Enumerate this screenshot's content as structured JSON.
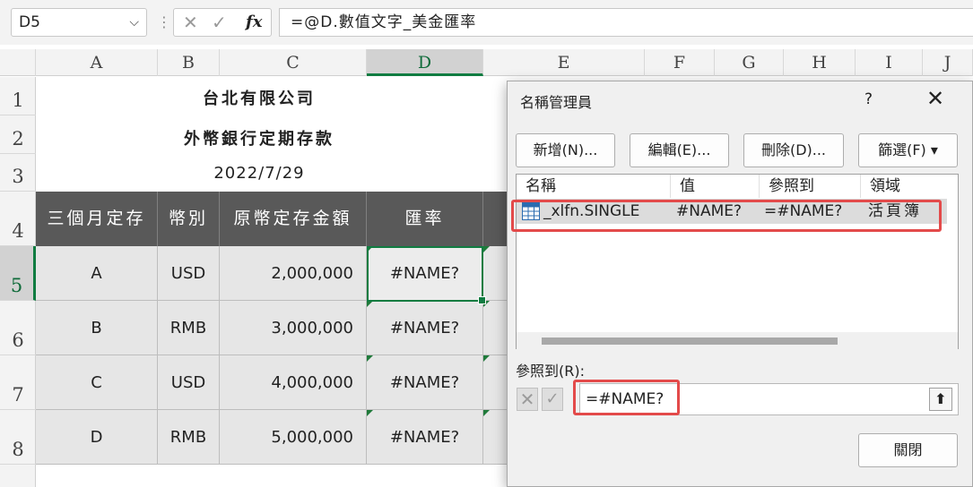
{
  "formula_bar": {
    "name_box": "D5",
    "cancel_icon": "✕",
    "enter_icon": "✓",
    "fx_label": "fx",
    "formula": "=@D.數值文字_美金匯率"
  },
  "columns": [
    "A",
    "B",
    "C",
    "D",
    "E",
    "F",
    "G",
    "H",
    "I",
    "J"
  ],
  "rows": [
    "1",
    "2",
    "3",
    "4",
    "5",
    "6",
    "7",
    "8"
  ],
  "sheet": {
    "title1": "台北有限公司",
    "title2": "外幣銀行定期存款",
    "date": "2022/7/29",
    "headers": [
      "三個月定存",
      "幣別",
      "原幣定存金額",
      "匯率"
    ],
    "data": [
      [
        "A",
        "USD",
        "2,000,000",
        "#NAME?"
      ],
      [
        "B",
        "RMB",
        "3,000,000",
        "#NAME?"
      ],
      [
        "C",
        "USD",
        "4,000,000",
        "#NAME?"
      ],
      [
        "D",
        "RMB",
        "5,000,000",
        "#NAME?"
      ]
    ]
  },
  "dialog": {
    "title": "名稱管理員",
    "help": "?",
    "close": "✕",
    "buttons": {
      "new": "新增(N)...",
      "edit": "編輯(E)...",
      "delete": "刪除(D)...",
      "filter": "篩選(F) ▾"
    },
    "list_headers": [
      "名稱",
      "值",
      "參照到",
      "領域"
    ],
    "row": {
      "name": "_xlfn.SINGLE",
      "value": "#NAME?",
      "refers": "=#NAME?",
      "scope": "活頁簿"
    },
    "refers_label": "參照到(R):",
    "refers_value": "=#NAME?",
    "close_button": "關閉"
  },
  "colors": {
    "accent": "#107c41",
    "header_bg": "#595959",
    "highlight": "#e34a4a"
  }
}
